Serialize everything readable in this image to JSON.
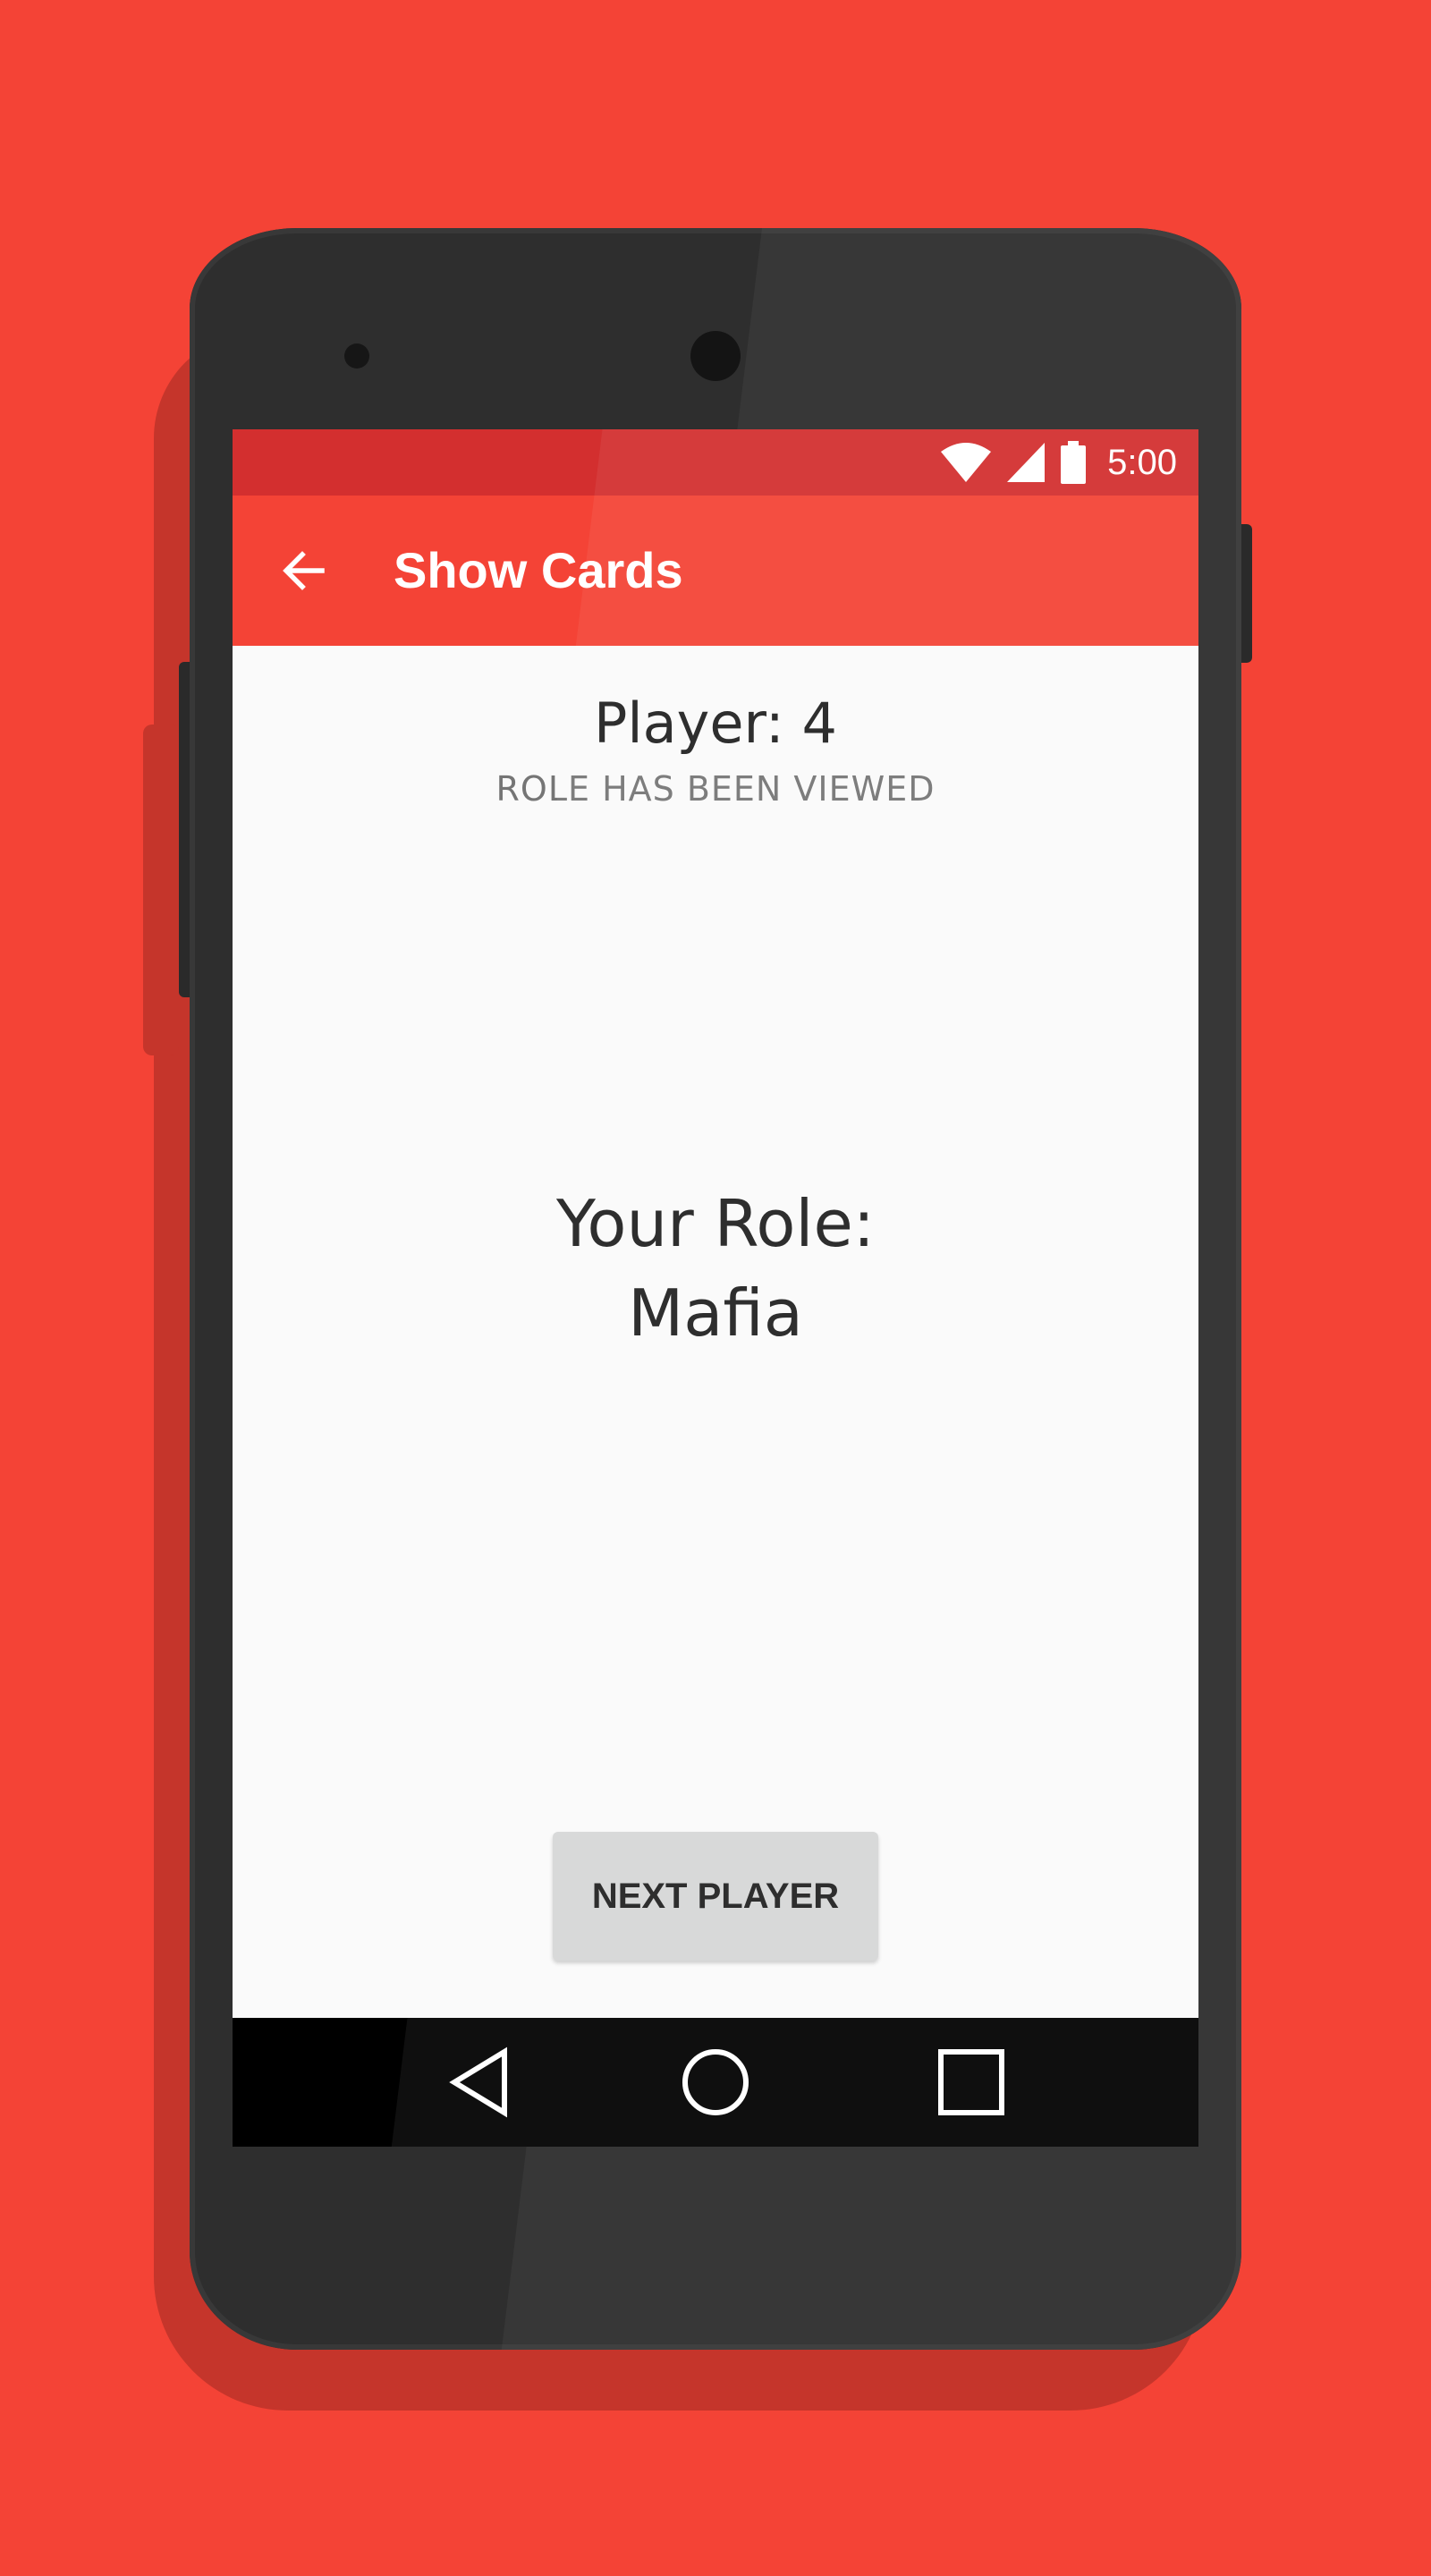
{
  "status_bar": {
    "time": "5:00",
    "icons": [
      "wifi-icon",
      "signal-icon",
      "battery-icon"
    ]
  },
  "app_bar": {
    "title": "Show Cards",
    "back_icon": "arrow-left-icon"
  },
  "main": {
    "player_label": "Player: 4",
    "status_label": "ROLE HAS BEEN VIEWED",
    "role_heading": "Your Role:",
    "role_value": "Mafia",
    "next_button_label": "NEXT PLAYER"
  },
  "nav_bar": {
    "icons": [
      "back-triangle-icon",
      "home-circle-icon",
      "recents-square-icon"
    ]
  },
  "colors": {
    "background": "#f44336",
    "status_bar": "#d32f2f",
    "app_bar": "#f44336",
    "screen": "#fafafa",
    "button": "#d6d7d7",
    "phone_body": "#2e2e2e"
  }
}
